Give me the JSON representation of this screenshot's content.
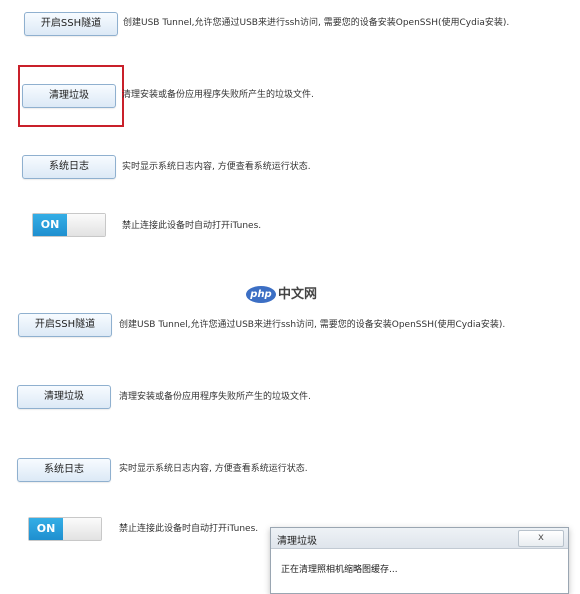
{
  "top_panel": {
    "ssh_button": "开启SSH隧道",
    "ssh_desc": "创建USB Tunnel,允许您通过USB来进行ssh访问, 需要您的设备安装OpenSSH(使用Cydia安装).",
    "clean_button": "清理垃圾",
    "clean_desc": "清理安装或备份应用程序失败所产生的垃圾文件.",
    "log_button": "系统日志",
    "log_desc": "实时显示系统日志内容, 方便查看系统运行状态.",
    "toggle_label": "ON",
    "toggle_state": "on",
    "itunes_desc": "禁止连接此设备时自动打开iTunes."
  },
  "bottom_panel": {
    "ssh_button": "开启SSH隧道",
    "ssh_desc": "创建USB Tunnel,允许您通过USB来进行ssh访问, 需要您的设备安装OpenSSH(使用Cydia安装).",
    "clean_button": "清理垃圾",
    "clean_desc": "清理安装或备份应用程序失败所产生的垃圾文件.",
    "log_button": "系统日志",
    "log_desc": "实时显示系统日志内容, 方便查看系统运行状态.",
    "toggle_label": "ON",
    "toggle_state": "on",
    "itunes_desc": "禁止连接此设备时自动打开iTunes."
  },
  "dialog": {
    "title": "清理垃圾",
    "close_label": "x",
    "message": "正在清理照相机缩略图缓存..."
  },
  "watermark": {
    "logo_text": "php",
    "site_text": "中文网"
  },
  "colors": {
    "highlight": "#c9202a",
    "toggle_on": "#1f8fcf",
    "button_border": "#8fb0cf"
  }
}
